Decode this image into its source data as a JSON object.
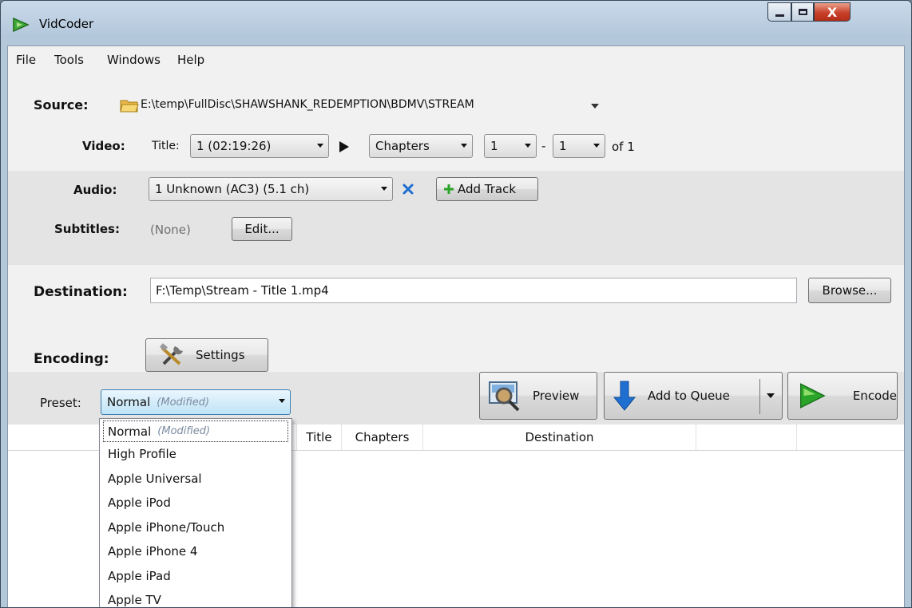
{
  "window": {
    "title": "VidCoder",
    "close_glyph": "X"
  },
  "menu": [
    "File",
    "Tools",
    "Windows",
    "Help"
  ],
  "source": {
    "label": "Source:",
    "path": "E:\\temp\\FullDisc\\SHAWSHANK_REDEMPTION\\BDMV\\STREAM"
  },
  "video": {
    "label": "Video:",
    "title_label": "Title:",
    "title_value": "1 (02:19:26)",
    "range_type": "Chapters",
    "start": "1",
    "dash": "-",
    "end": "1",
    "of_text": "of 1"
  },
  "audio": {
    "label": "Audio:",
    "track": "1 Unknown (AC3) (5.1 ch)",
    "add_track": "Add Track"
  },
  "subtitles": {
    "label": "Subtitles:",
    "value": "(None)",
    "edit": "Edit..."
  },
  "destination": {
    "label": "Destination:",
    "path": "F:\\Temp\\Stream - Title 1.mp4",
    "browse": "Browse..."
  },
  "encoding": {
    "label": "Encoding:",
    "settings": "Settings"
  },
  "preset": {
    "label": "Preset:",
    "value": "Normal",
    "modified": "(Modified)"
  },
  "actions": {
    "preview": "Preview",
    "add_to_queue": "Add to Queue",
    "encode": "Encode"
  },
  "table": {
    "columns": [
      "Title",
      "Chapters",
      "Destination"
    ]
  },
  "preset_options": [
    {
      "name": "Normal",
      "modified": "(Modified)"
    },
    {
      "name": "High Profile"
    },
    {
      "name": "Apple Universal"
    },
    {
      "name": "Apple iPod"
    },
    {
      "name": "Apple iPhone/Touch"
    },
    {
      "name": "Apple iPhone 4"
    },
    {
      "name": "Apple iPad"
    },
    {
      "name": "Apple TV"
    }
  ],
  "colors": {
    "accent_blue": "#1e6fd0",
    "green": "#2aa52a",
    "remove_x": "#1f6fd1"
  },
  "icons": [
    "vidcoder-app-icon",
    "folder-icon",
    "play-triangle-icon",
    "remove-x-icon",
    "plus-icon",
    "tools-icon",
    "preview-magnifier-icon",
    "down-arrow-icon",
    "encode-play-icon"
  ]
}
